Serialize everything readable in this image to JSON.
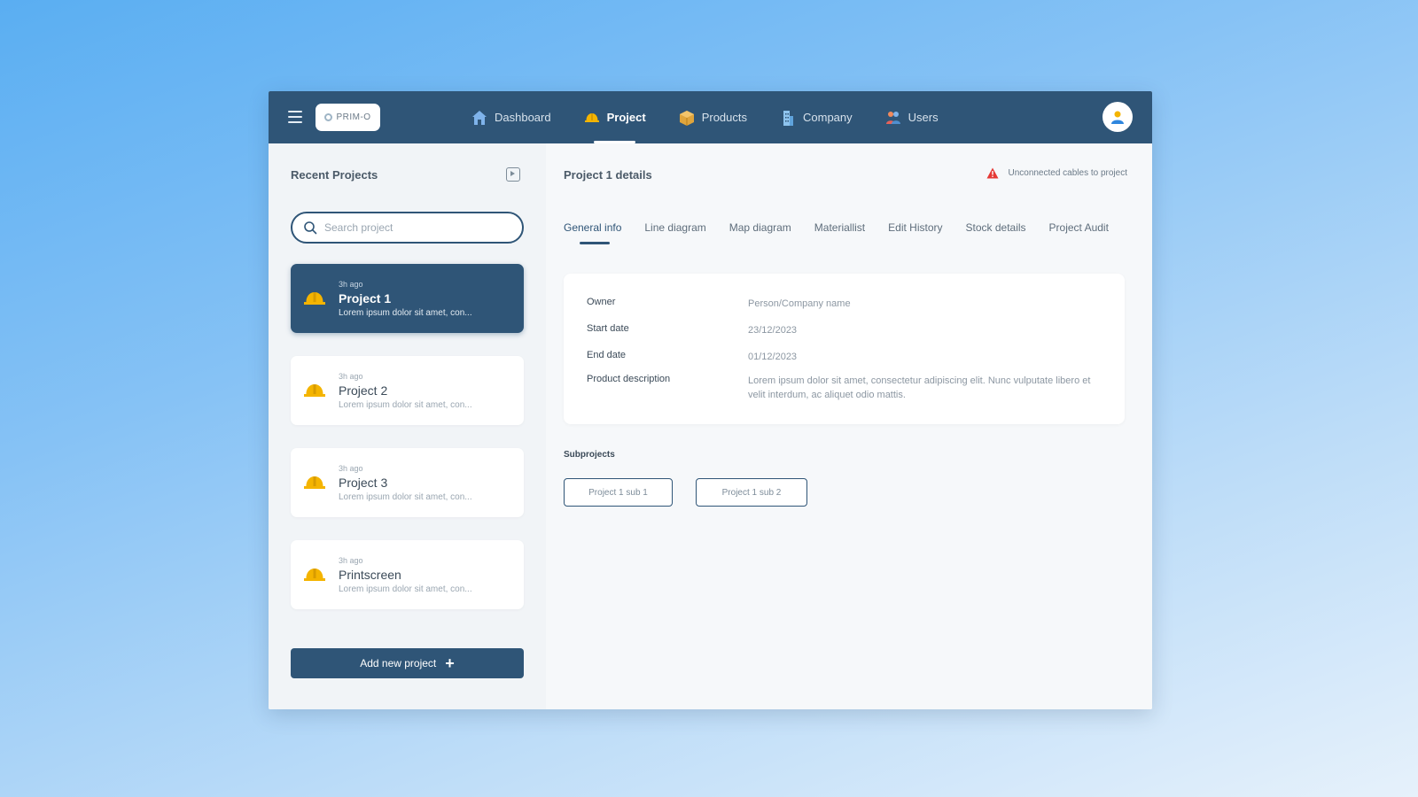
{
  "app": {
    "logo_text": "PRIM-O"
  },
  "nav": {
    "items": [
      {
        "label": "Dashboard",
        "icon": "home-icon"
      },
      {
        "label": "Project",
        "icon": "hardhat-icon"
      },
      {
        "label": "Products",
        "icon": "box-icon"
      },
      {
        "label": "Company",
        "icon": "building-icon"
      },
      {
        "label": "Users",
        "icon": "users-icon"
      }
    ],
    "active": "Project"
  },
  "sidebar": {
    "title": "Recent Projects",
    "search_placeholder": "Search project",
    "projects": [
      {
        "time": "3h ago",
        "name": "Project 1",
        "desc": "Lorem ipsum dolor sit amet, con...",
        "active": true
      },
      {
        "time": "3h ago",
        "name": "Project 2",
        "desc": "Lorem ipsum dolor sit amet, con...",
        "active": false
      },
      {
        "time": "3h ago",
        "name": "Project 3",
        "desc": "Lorem ipsum dolor sit amet, con...",
        "active": false
      },
      {
        "time": "3h ago",
        "name": "Printscreen",
        "desc": "Lorem ipsum dolor sit amet, con...",
        "active": false
      }
    ],
    "add_button_label": "Add new project"
  },
  "details": {
    "title": "Project 1 details",
    "warning": "Unconnected cables to project",
    "tabs": [
      "General info",
      "Line diagram",
      "Map diagram",
      "Materiallist",
      "Edit History",
      "Stock details",
      "Project Audit"
    ],
    "active_tab": "General info",
    "info": {
      "owner_label": "Owner",
      "owner_value": "Person/Company name",
      "start_label": "Start date",
      "start_value": "23/12/2023",
      "end_label": "End date",
      "end_value": "01/12/2023",
      "desc_label": "Product description",
      "desc_value": "Lorem ipsum dolor sit amet, consectetur adipiscing elit. Nunc vulputate libero et velit interdum, ac aliquet odio mattis."
    },
    "subprojects_title": "Subprojects",
    "subprojects": [
      "Project 1 sub 1",
      "Project 1 sub 2"
    ]
  },
  "colors": {
    "primary": "#2f5577",
    "accent_warning": "#f4b400",
    "alert": "#e53935"
  }
}
